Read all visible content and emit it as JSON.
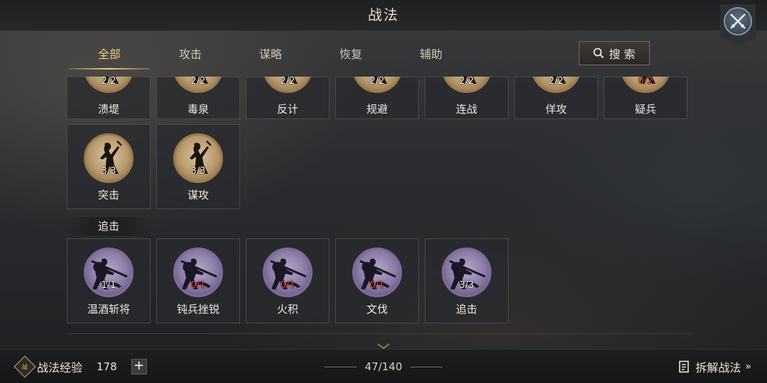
{
  "header": {
    "title": "战法"
  },
  "tabs": [
    {
      "label": "全部",
      "active": true
    },
    {
      "label": "攻击",
      "active": false
    },
    {
      "label": "谋略",
      "active": false
    },
    {
      "label": "恢复",
      "active": false
    },
    {
      "label": "辅助",
      "active": false
    }
  ],
  "search": {
    "label": "搜 索"
  },
  "rows": {
    "top": [
      {
        "name": "溃堤",
        "count": "2/2",
        "zero": false,
        "medal": "gold",
        "icon": "warrior-icon"
      },
      {
        "name": "毒泉",
        "count": "2/2",
        "zero": false,
        "medal": "gold",
        "icon": "warrior-icon"
      },
      {
        "name": "反计",
        "count": "2/2",
        "zero": false,
        "medal": "gold",
        "icon": "warrior-icon"
      },
      {
        "name": "规避",
        "count": "2/2",
        "zero": false,
        "medal": "gold",
        "icon": "warrior-icon"
      },
      {
        "name": "连战",
        "count": "2/2",
        "zero": false,
        "medal": "gold",
        "icon": "warrior-icon"
      },
      {
        "name": "佯攻",
        "count": "2/2",
        "zero": false,
        "medal": "gold",
        "icon": "warrior-icon"
      },
      {
        "name": "疑兵",
        "count": "0/2",
        "zero": true,
        "medal": "gold",
        "icon": "warrior-icon"
      }
    ],
    "middle": [
      {
        "name": "突击",
        "count": "3/3",
        "zero": false,
        "medal": "gold",
        "icon": "warrior-icon"
      },
      {
        "name": "谋攻",
        "count": "3/3",
        "zero": false,
        "medal": "gold",
        "icon": "warrior-icon"
      }
    ],
    "section_label": "追击",
    "bottom": [
      {
        "name": "温酒斩将",
        "count": "1/1",
        "zero": false,
        "medal": "purple",
        "icon": "rider-icon"
      },
      {
        "name": "钝兵挫锐",
        "count": "0/1",
        "zero": true,
        "medal": "purple",
        "icon": "rider-icon"
      },
      {
        "name": "火积",
        "count": "0/1",
        "zero": true,
        "medal": "purple",
        "icon": "rider-icon"
      },
      {
        "name": "文伐",
        "count": "0/1",
        "zero": true,
        "medal": "purple",
        "icon": "rider-icon"
      },
      {
        "name": "追击",
        "count": "3/3",
        "zero": false,
        "medal": "purple",
        "icon": "rider-icon"
      }
    ]
  },
  "footer": {
    "exp_label": "战法经验",
    "exp_icon_text": "战",
    "exp_value": "178",
    "pager": "47/140",
    "dismantle_label": "拆解战法"
  },
  "colors": {
    "accent": "#ecc98a",
    "zero_count": "#d4483e"
  }
}
